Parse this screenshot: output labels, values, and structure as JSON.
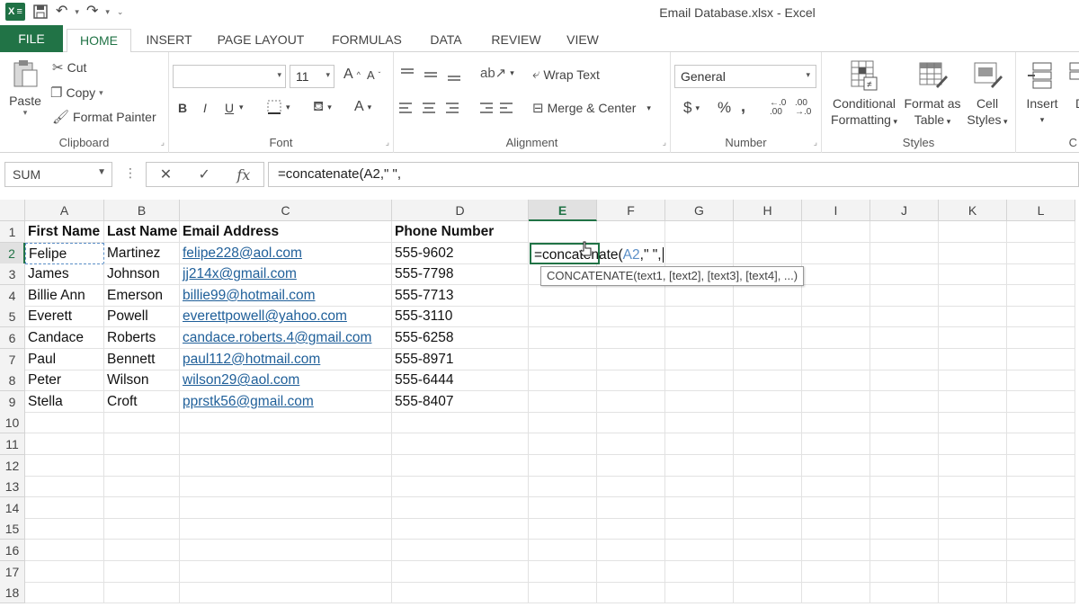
{
  "titlebar": {
    "title": "Email Database.xlsx - Excel",
    "logo": "X ≡",
    "undo": "↶",
    "redo": "↷",
    "customize": "⌄"
  },
  "tabs": [
    "FILE",
    "HOME",
    "INSERT",
    "PAGE LAYOUT",
    "FORMULAS",
    "DATA",
    "REVIEW",
    "VIEW"
  ],
  "ribbon": {
    "clipboard": {
      "label": "Clipboard",
      "paste": "Paste",
      "cut": "Cut",
      "copy": "Copy",
      "format_painter": "Format Painter"
    },
    "font": {
      "label": "Font",
      "font_name": "",
      "font_size": "11",
      "bold": "B",
      "italic": "I",
      "underline": "U",
      "grow": "A",
      "shrink": "A",
      "fill": "⬛",
      "font_color": "A"
    },
    "alignment": {
      "label": "Alignment",
      "wrap_text": "Wrap Text",
      "merge_center": "Merge & Center"
    },
    "number": {
      "label": "Number",
      "format": "General",
      "currency": "$",
      "percent": "%",
      "comma": ",",
      "inc_decimal": "←.0\n.00",
      "dec_decimal": ".00\n→.0"
    },
    "styles": {
      "label": "Styles",
      "conditional_1": "Conditional",
      "conditional_2": "Formatting",
      "format_as_1": "Format as",
      "format_as_2": "Table",
      "cell_styles_1": "Cell",
      "cell_styles_2": "Styles"
    },
    "cells": {
      "label": "C",
      "insert": "Insert",
      "delete": "D"
    }
  },
  "formulabar": {
    "namebox": "SUM",
    "cancel": "✕",
    "enter": "✓",
    "fx": "fx",
    "formula": "=concatenate(A2,\" \","
  },
  "sheet": {
    "columns": [
      "A",
      "B",
      "C",
      "D",
      "E",
      "F",
      "G",
      "H",
      "I",
      "J",
      "K",
      "L"
    ],
    "rows": [
      "1",
      "2",
      "3",
      "4",
      "5",
      "6",
      "7",
      "8",
      "9",
      "10",
      "11",
      "12",
      "13",
      "14",
      "15",
      "16",
      "17",
      "18"
    ],
    "header": [
      "First Name",
      "Last Name",
      "Email Address",
      "Phone Number"
    ],
    "data": [
      [
        "Felipe",
        "Martinez",
        "felipe228@aol.com",
        "555-9602"
      ],
      [
        "James",
        "Johnson",
        "jj214x@gmail.com",
        "555-7798"
      ],
      [
        "Billie Ann",
        "Emerson",
        "billie99@hotmail.com",
        "555-7713"
      ],
      [
        "Everett",
        "Powell",
        "everettpowell@yahoo.com",
        "555-3110"
      ],
      [
        "Candace",
        "Roberts",
        "candace.roberts.4@gmail.com",
        "555-6258"
      ],
      [
        "Paul",
        "Bennett",
        "paul112@hotmail.com",
        "555-8971"
      ],
      [
        "Peter",
        "Wilson",
        "wilson29@aol.com",
        "555-6444"
      ],
      [
        "Stella",
        "Croft",
        "pprstk56@gmail.com",
        "555-8407"
      ]
    ],
    "active_cell": {
      "prefix": "=concatenate(",
      "ref": "A2",
      "suffix": ",\" \","
    },
    "tooltip": "CONCATENATE(text1, [text2], [text3], [text4], ...)"
  },
  "colors": {
    "excel_green": "#217346",
    "link_blue": "#1f5f99",
    "ref_blue": "#5b8fc7"
  }
}
